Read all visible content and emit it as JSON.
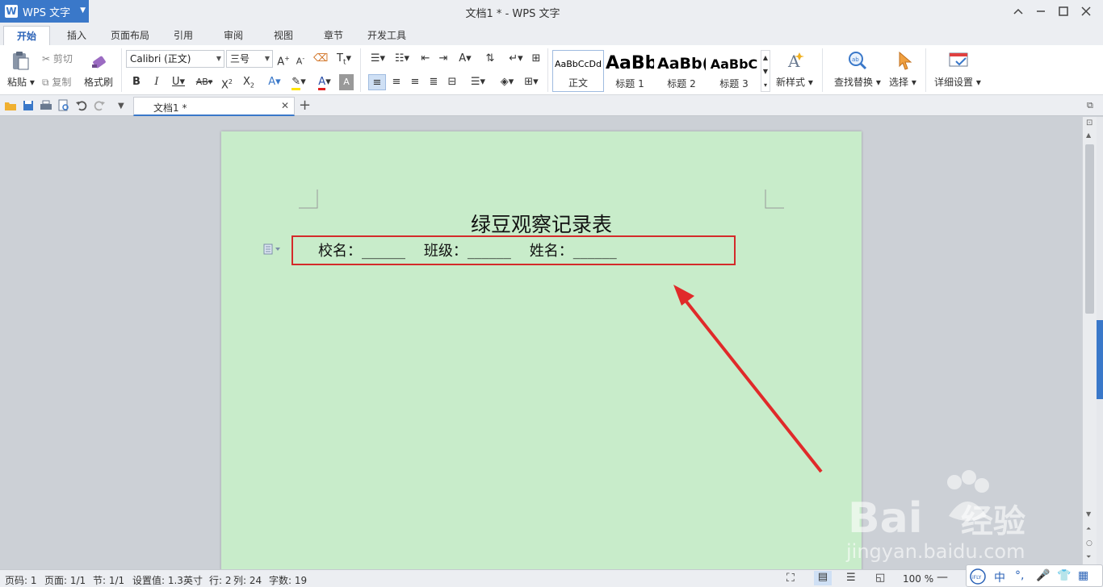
{
  "app": {
    "name": "WPS 文字",
    "window_title": "文档1 * - WPS 文字"
  },
  "ribbon_tabs": [
    "开始",
    "插入",
    "页面布局",
    "引用",
    "审阅",
    "视图",
    "章节",
    "开发工具"
  ],
  "ribbon": {
    "paste": "粘贴",
    "cut": "剪切",
    "copy": "复制",
    "format_painter": "格式刷",
    "font_name": "Calibri (正文)",
    "font_size": "三号",
    "styles": [
      {
        "preview": "AaBbCcDd",
        "name": "正文"
      },
      {
        "preview": "AaBb",
        "name": "标题 1"
      },
      {
        "preview": "AaBb(",
        "name": "标题 2"
      },
      {
        "preview": "AaBbC",
        "name": "标题 3"
      }
    ],
    "new_style": "新样式",
    "find_replace": "查找替换",
    "select": "选择",
    "detail_settings": "详细设置"
  },
  "doc_tab": {
    "label": "文档1 *"
  },
  "document": {
    "heading": "绿豆观察记录表",
    "line": "校名：______    班级：______    姓名：______"
  },
  "status": {
    "page_code": "页码: 1",
    "pages": "页面: 1/1",
    "section": "节: 1/1",
    "setting": "设置值: 1.3英寸",
    "row": "行: 2",
    "col": "列: 24",
    "words": "字数: 19",
    "zoom": "100 %"
  },
  "ime": {
    "mode": "中"
  },
  "colors": {
    "accent": "#3a78c9",
    "page_bg": "#c8ecca",
    "highlight_border": "#d42a2a",
    "arrow": "#e02a2a"
  }
}
